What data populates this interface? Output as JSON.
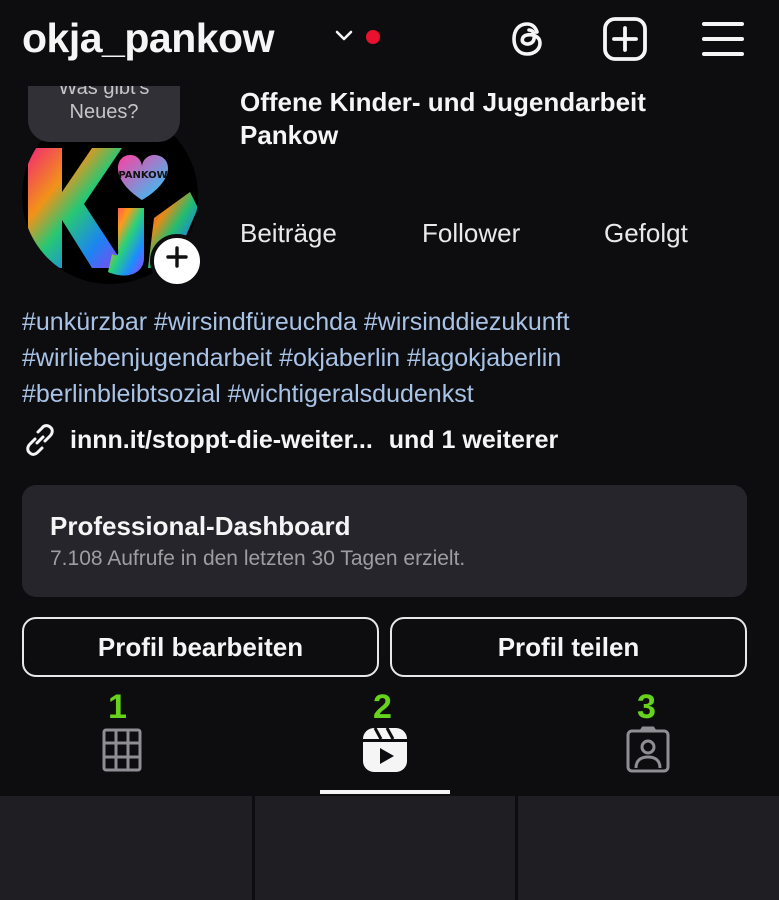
{
  "header": {
    "username": "okja_pankow",
    "accent_dot_color": "#e8122f"
  },
  "profile": {
    "note": {
      "line1": "Was gibt's",
      "line2": "Neues?"
    },
    "avatar_text": "PANKOW",
    "full_name_line1": "Offene Kinder- und Jugendarbeit",
    "full_name_line2": "Pankow",
    "stats": {
      "posts_label": "Beiträge",
      "followers_label": "Follower",
      "following_label": "Gefolgt"
    },
    "bio_lines": [
      "#unkürzbar #wirsindfüreuchda  #wirsinddiezukunft",
      "#wirliebenjugendarbeit  #okjaberlin #lagokjaberlin",
      "#berlinbleibtsozial #wichtigeralsdudenkst"
    ],
    "link_text": "innn.it/stoppt-die-weiter...",
    "link_more": "und 1 weiterer"
  },
  "dashboard": {
    "title": "Professional-Dashboard",
    "subtitle": "7.108 Aufrufe in den letzten 30 Tagen erzielt."
  },
  "buttons": {
    "edit_profile": "Profil bearbeiten",
    "share_profile": "Profil teilen"
  },
  "tabs": {
    "markers": [
      "1",
      "2",
      "3"
    ],
    "marker_color": "#66d21c",
    "items": [
      {
        "icon": "grid-icon"
      },
      {
        "icon": "reels-icon",
        "active": true
      },
      {
        "icon": "tagged-icon"
      }
    ]
  }
}
